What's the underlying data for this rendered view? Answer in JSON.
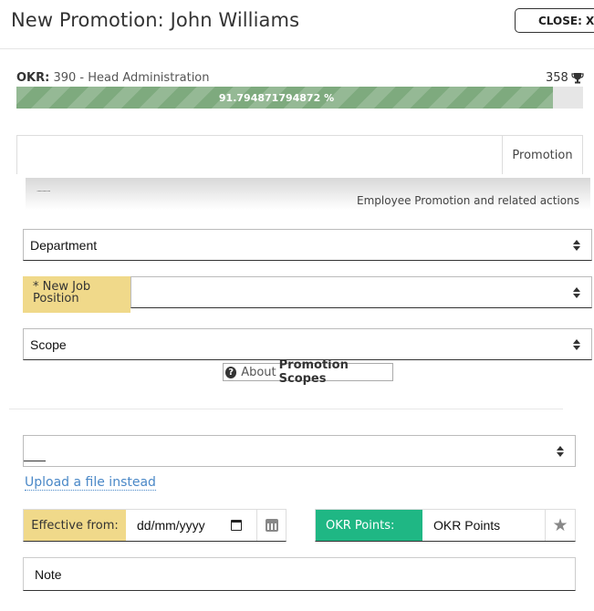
{
  "header": {
    "title": "New Promotion: John Williams",
    "close_label": "CLOSE: X"
  },
  "okr": {
    "label": "OKR:",
    "value": "390 - Head Administration",
    "points": "358",
    "progress_text": "91.794871794872 %",
    "progress_percent": 91.794871794872
  },
  "tabs": {
    "active": "Promotion",
    "dots": "............",
    "description": "Employee Promotion and related actions"
  },
  "form": {
    "department": "Department",
    "new_job_label": "* New Job Position",
    "new_job_value": "",
    "scope": "Scope",
    "about_prefix": "About",
    "about_strong": "Promotion Scopes",
    "file_select_value": "",
    "upload_link": "Upload a file instead",
    "effective_label": "Effective from:",
    "effective_value": "dd/mm/yyyy",
    "okr_points_label": "OKR Points:",
    "okr_points_placeholder": "OKR Points",
    "note_placeholder": "Note"
  },
  "colors": {
    "progress": "#7eaa7e",
    "label_yellow": "#f0d98a",
    "okr_green": "#1fb784",
    "link_blue": "#4a88c7"
  },
  "icons": {
    "trophy": "trophy-icon",
    "question": "question-circle-icon",
    "calendar": "calendar-icon",
    "star": "star-icon",
    "sort": "sort-arrows-icon"
  }
}
